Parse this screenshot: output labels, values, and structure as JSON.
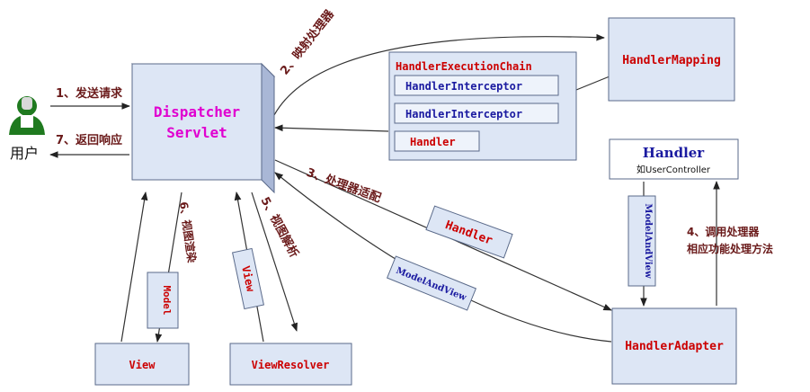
{
  "colors": {
    "box_fill": "#dde6f5",
    "box_border": "#5a6a8a",
    "red_text": "#cc0000",
    "blue_text": "#1a1aa0",
    "magenta_text": "#e000d0",
    "label_text": "#6a1a1a",
    "arrow": "#222222"
  },
  "user": {
    "label": "用户",
    "icon": "user-icon"
  },
  "dispatcher": {
    "line1": "Dispatcher",
    "line2": "Servlet"
  },
  "handler_mapping": {
    "label": "HandlerMapping"
  },
  "execution_chain": {
    "title": "HandlerExecutionChain",
    "items": [
      "HandlerInterceptor",
      "HandlerInterceptor",
      "Handler"
    ]
  },
  "handler": {
    "title": "Handler",
    "subtitle": "如UserController"
  },
  "handler_adapter": {
    "label": "HandlerAdapter"
  },
  "view": {
    "label": "View"
  },
  "view_resolver": {
    "label": "ViewResolver"
  },
  "tags": {
    "handler": "Handler",
    "model_and_view": "ModelAndView",
    "model_and_view_vertical": "ModelAndView",
    "view": "View",
    "model": "Model"
  },
  "steps": {
    "s1": "1、发送请求",
    "s2": "2、映射处理器",
    "s3": "3、处理器适配",
    "s4_line1": "4、调用处理器",
    "s4_line2": "相应功能处理方法",
    "s5": "5、视图解析",
    "s6": "6、视图渲染",
    "s7": "7、返回响应"
  }
}
